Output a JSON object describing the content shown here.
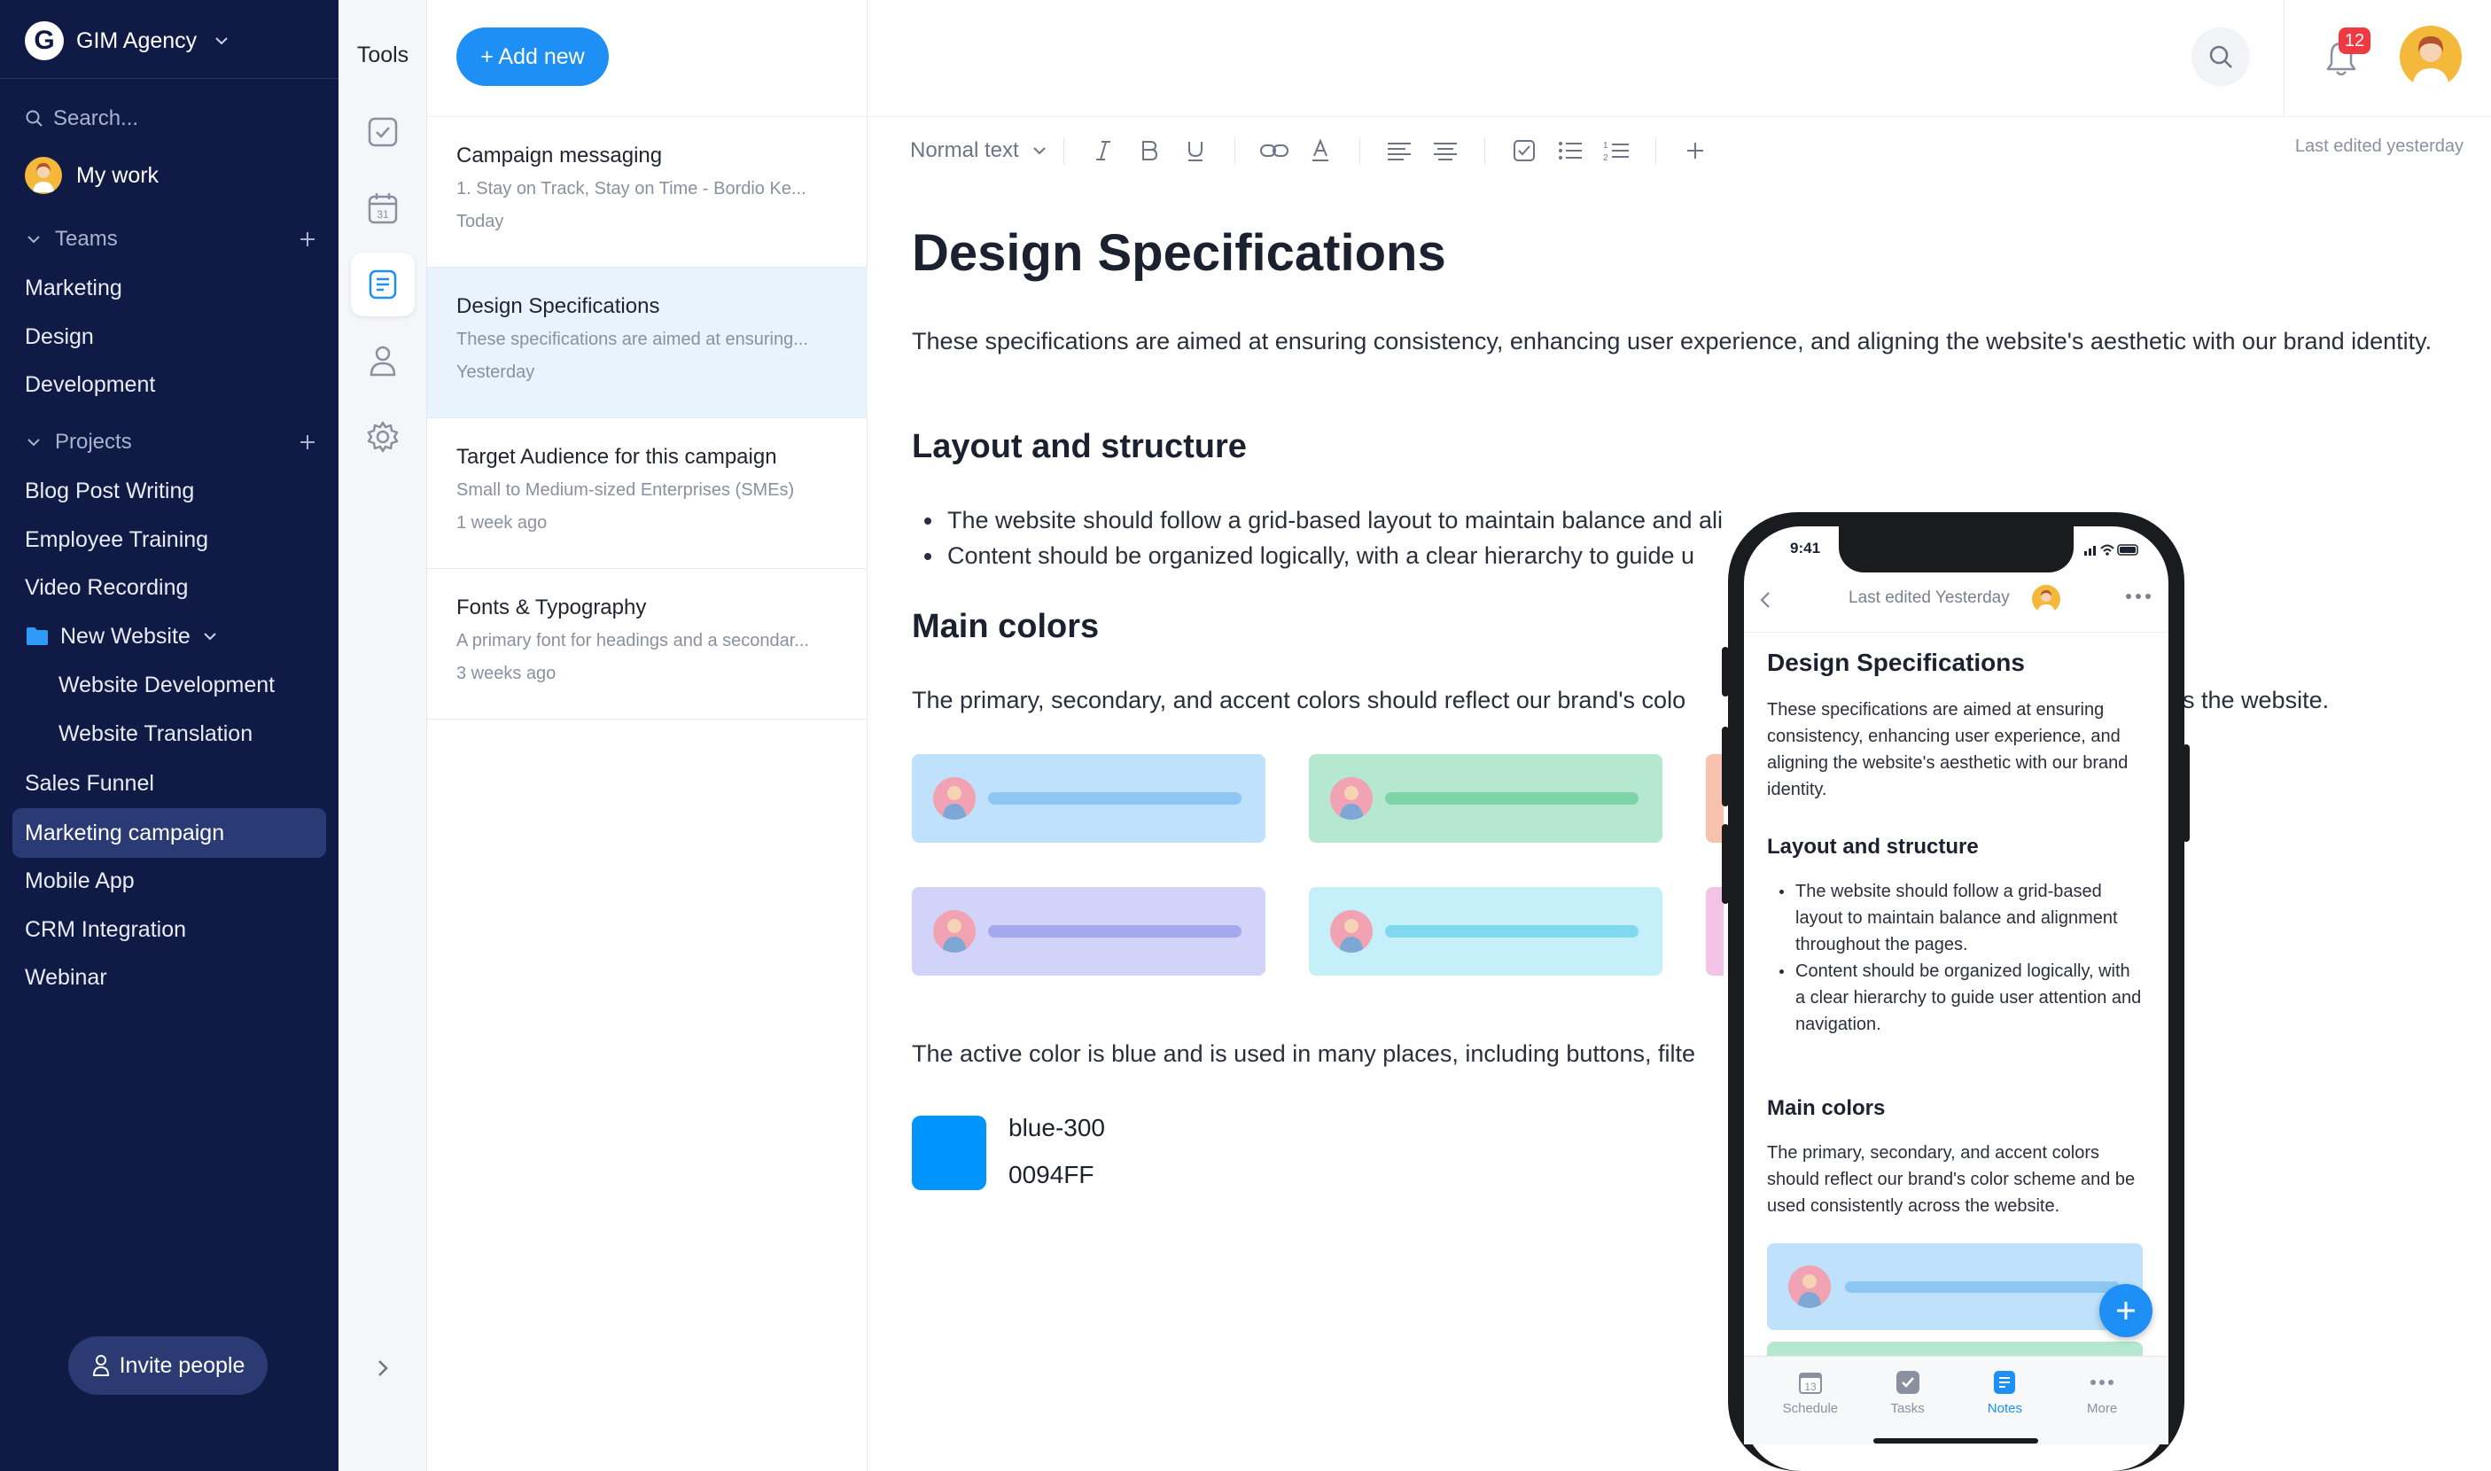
{
  "sidebar": {
    "workspace": {
      "logo": "G",
      "name": "GIM Agency"
    },
    "search_placeholder": "Search...",
    "my_work": "My work",
    "teams_header": "Teams",
    "teams": [
      "Marketing",
      "Design",
      "Development"
    ],
    "projects_header": "Projects",
    "projects": [
      "Blog Post Writing",
      "Employee Training",
      "Video Recording",
      "New Website",
      "Website Development",
      "Website Translation",
      "Sales Funnel",
      "Marketing campaign",
      "Mobile App",
      "CRM Integration",
      "Webinar"
    ],
    "active_project": "Marketing campaign",
    "invite_label": "Invite people"
  },
  "tools": {
    "title": "Tools",
    "items": [
      "tasks-icon",
      "calendar-icon",
      "notes-icon",
      "people-icon",
      "settings-icon"
    ],
    "active": "notes-icon"
  },
  "notes_panel": {
    "add_new_label": "+ Add new",
    "items": [
      {
        "title": "Campaign messaging",
        "snippet": "1. Stay on Track, Stay on Time - Bordio Ke...",
        "date": "Today"
      },
      {
        "title": "Design Specifications",
        "snippet": "These specifications are aimed at ensuring...",
        "date": "Yesterday"
      },
      {
        "title": "Target Audience for this campaign",
        "snippet": "Small to Medium-sized Enterprises (SMEs)",
        "date": "1 week ago"
      },
      {
        "title": "Fonts & Typography",
        "snippet": "A primary font for headings and a secondar...",
        "date": "3 weeks ago"
      }
    ],
    "selected_index": 1
  },
  "header": {
    "notification_count": "12"
  },
  "editor": {
    "text_style": "Normal text",
    "last_edited": "Last edited yesterday",
    "title": "Design Specifications",
    "intro": "These specifications are aimed at ensuring consistency, enhancing user experience, and aligning the website's aesthetic with our brand identity.",
    "h_layout": "Layout and structure",
    "bullets": [
      "The website should follow a grid-based layout to maintain balance and ali",
      "Content should be organized logically, with a clear hierarchy to guide u"
    ],
    "h_colors": "Main colors",
    "colors_text_left": "The primary, secondary, and accent colors should reflect our brand's colo",
    "colors_text_right": "s the website.",
    "active_text": "The active color is blue and is used in many places, including buttons, filte",
    "color_name": "blue-300",
    "color_hex": "0094FF",
    "colors": {
      "blue_card": "#bfe1fb",
      "green_card": "#b6e7cf",
      "purple_card": "#d2d3f8",
      "cyan_card": "#c5eff9",
      "accent": "#0094FF"
    }
  },
  "phone": {
    "time": "9:41",
    "last_edited": "Last edited Yesterday",
    "title": "Design Specifications",
    "intro": "These specifications are aimed at ensuring consistency, enhancing user experience, and aligning the website's aesthetic with our brand identity.",
    "h_layout": "Layout and structure",
    "bullet1": "The website should follow a grid-based layout to maintain balance and alignment throughout the pages.",
    "bullet2_a": "Content should be organized logically, with",
    "bullet2_b": "a clear hierarchy to guide user attention and navigation.",
    "h_colors": "Main colors",
    "colors_text": "The primary, secondary, and accent colors should reflect our brand's color scheme and be used consistently across the website.",
    "tabs": [
      "Schedule",
      "Tasks",
      "Notes",
      "More"
    ],
    "calendar_day": "13",
    "active_tab": "Notes"
  }
}
